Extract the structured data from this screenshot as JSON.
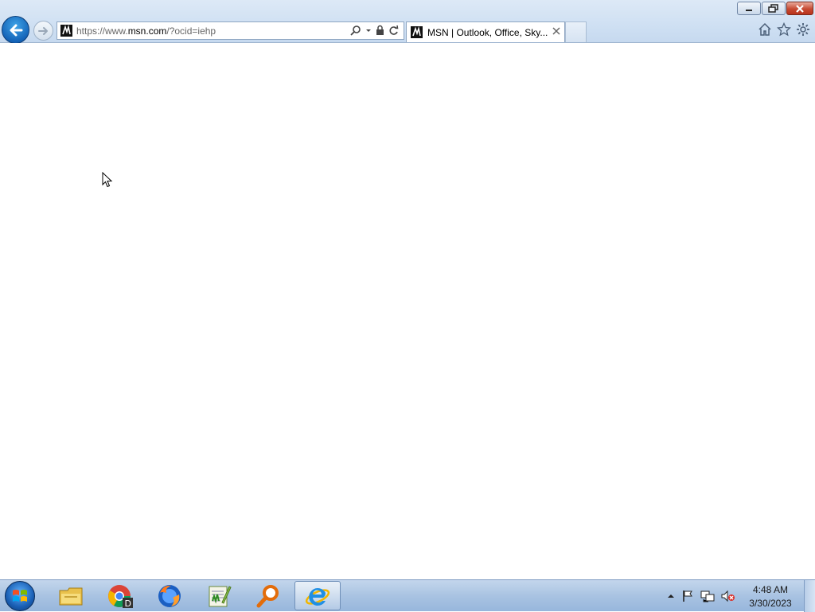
{
  "browser": {
    "address_url_prefix": "https://www.",
    "address_url_host": "msn.com",
    "address_url_suffix": "/?ocid=iehp",
    "tab_title": "MSN | Outlook, Office, Sky...",
    "favicon": "msn-favicon",
    "nav_back_icon": "back-arrow-icon",
    "nav_forward_icon": "forward-arrow-icon",
    "toolbar_icons": [
      "home-icon",
      "favorites-star-icon",
      "settings-gear-icon"
    ]
  },
  "taskbar": {
    "pinned": [
      {
        "name": "file-explorer"
      },
      {
        "name": "chrome"
      },
      {
        "name": "firefox"
      },
      {
        "name": "notepad-plus-plus"
      },
      {
        "name": "search-magnifier-app"
      },
      {
        "name": "internet-explorer",
        "active": true
      }
    ],
    "clock_time": "4:48 AM",
    "clock_date": "3/30/2023"
  },
  "colors": {
    "accent_blue": "#1564b8",
    "close_red": "#c74a32",
    "taskbar": "#a9c3e2"
  }
}
